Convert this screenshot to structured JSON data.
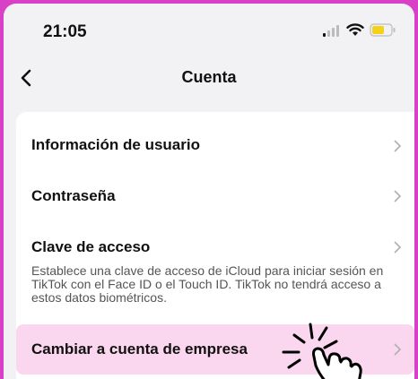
{
  "status_bar": {
    "time": "21:05",
    "icons": [
      "signal-icon",
      "wifi-icon",
      "battery-icon"
    ]
  },
  "nav": {
    "title": "Cuenta",
    "back_icon": "chevron-left-icon"
  },
  "items": [
    {
      "label": "Información de usuario"
    },
    {
      "label": "Contraseña"
    },
    {
      "label": "Clave de acceso",
      "description": "Establece una clave de acceso de iCloud para iniciar sesión en TikTok con el Face ID o el Touch ID. TikTok no tendrá acceso a estos datos biométricos."
    },
    {
      "label": "Cambiar a cuenta de empresa",
      "highlighted": true
    }
  ],
  "colors": {
    "frame": "#d940c8",
    "highlight": "#fbd7ef",
    "battery": "#f5d219"
  }
}
